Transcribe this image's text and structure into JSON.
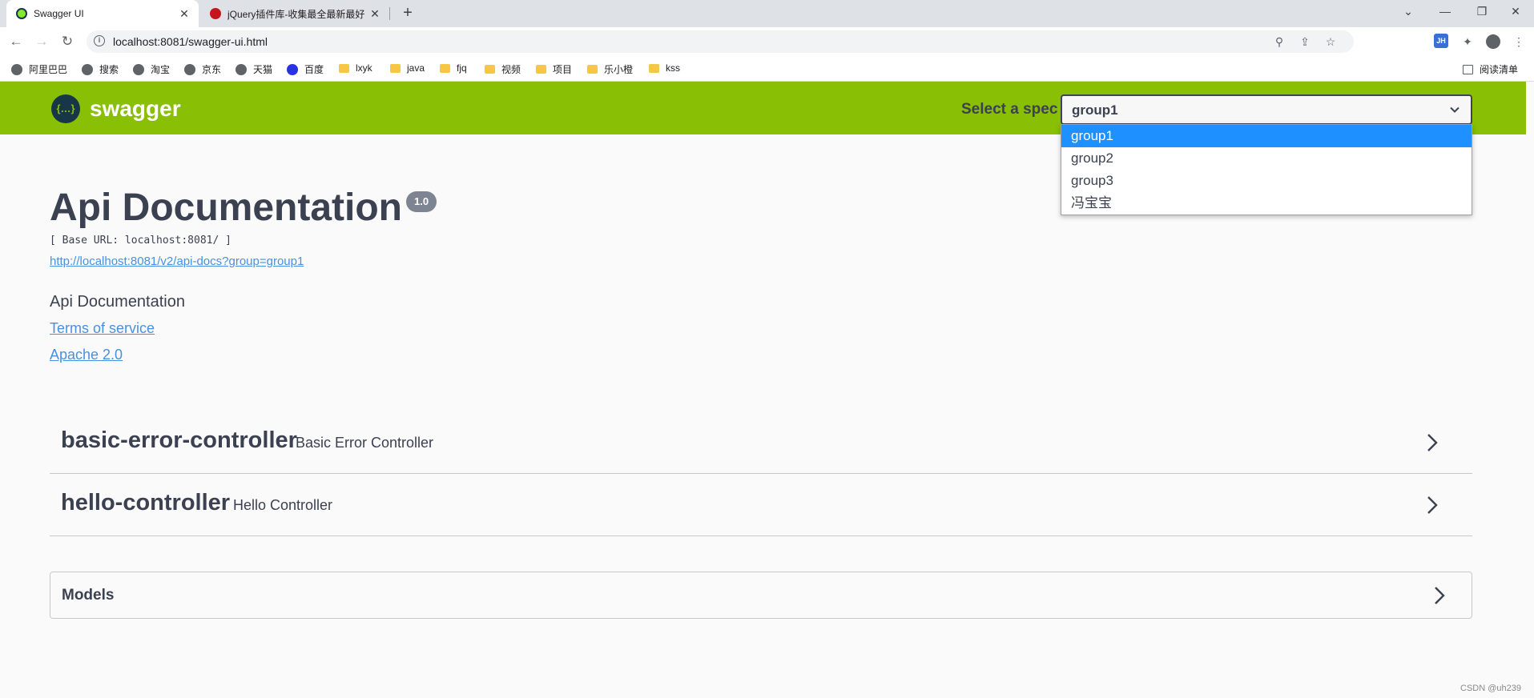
{
  "browser": {
    "tabs": [
      {
        "title": "Swagger UI",
        "active": true
      },
      {
        "title": "jQuery插件库-收集最全最新最好",
        "active": false
      }
    ],
    "address_url": "localhost:8081/swagger-ui.html",
    "bookmarks": [
      "阿里巴巴",
      "搜索",
      "淘宝",
      "京东",
      "天猫",
      "百度",
      "lxyk",
      "java",
      "fjq",
      "视频",
      "项目",
      "乐小橙",
      "kss"
    ],
    "reading_list": "阅读清单"
  },
  "swagger": {
    "logo_text": "swagger",
    "logo_glyph": "{…}",
    "spec_label": "Select a spec",
    "selected_spec": "group1",
    "spec_options": [
      "group1",
      "group2",
      "group3",
      "冯宝宝"
    ],
    "highlighted_option": "group1"
  },
  "info": {
    "title": "Api Documentation",
    "version": "1.0",
    "base_url": "[ Base URL: localhost:8081/ ]",
    "spec_link": "http://localhost:8081/v2/api-docs?group=group1",
    "description": "Api Documentation",
    "terms_link": "Terms of service",
    "license_link": "Apache 2.0"
  },
  "controllers": [
    {
      "name": "basic-error-controller",
      "description": "Basic Error Controller"
    },
    {
      "name": "hello-controller",
      "description": "Hello Controller"
    }
  ],
  "models": {
    "label": "Models"
  },
  "watermark": "CSDN @uh239",
  "colors": {
    "topbar": "#89bf04",
    "link": "#4990e2",
    "text": "#3b4151",
    "selected_option": "#1e90ff"
  }
}
